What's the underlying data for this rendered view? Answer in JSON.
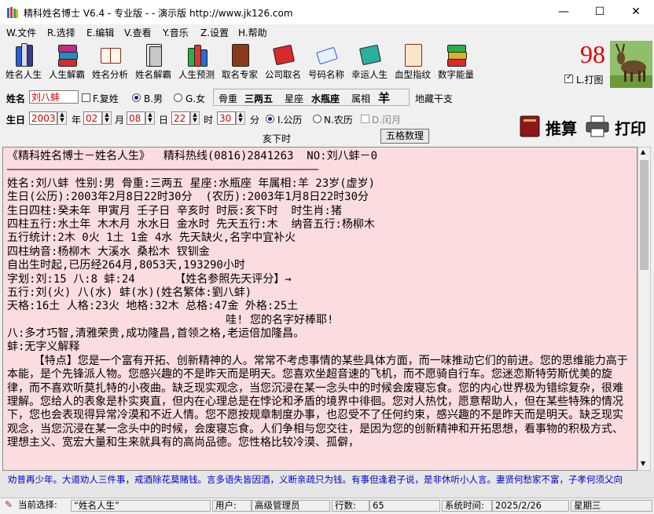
{
  "window": {
    "title": "精科姓名博士 V6.4 - 专业版 - - 演示版  http://www.jk126.com",
    "minimize": "—",
    "maximize": "☐",
    "close": "✕"
  },
  "menu": [
    "W.文件",
    "R.选择",
    "E.编辑",
    "V.查看",
    "Y.音乐",
    "Z.设置",
    "H.帮助"
  ],
  "toolbar": [
    "姓名人生",
    "人生解霸",
    "姓名分析",
    "姓名解霸",
    "人生预测",
    "取名专家",
    "公司取名",
    "号码名称",
    "幸运人生",
    "血型指纹",
    "数字能量"
  ],
  "score": {
    "value": "98",
    "print_label": "L.打图",
    "print_checked": true
  },
  "row1": {
    "name_label": "姓名",
    "name_value": "刘八蚌",
    "fuxing_label": "F.复姓",
    "male_label": "B.男",
    "female_label": "G.女",
    "gugu_label": "骨重",
    "gugu_value": "三两五",
    "xingzuo_label": "星座",
    "xingzuo_value": "水瓶座",
    "shuxiang_label": "属相",
    "shuxiang_value": "羊",
    "dizhi_label": "地藏干支"
  },
  "row2": {
    "birth_label": "生日",
    "year": "2003",
    "year_unit": "年",
    "month": "02",
    "month_unit": "月",
    "day": "08",
    "day_unit": "日",
    "hour": "22",
    "hour_unit": "时",
    "minute": "30",
    "minute_unit": "分",
    "gongli_label": "I.公历",
    "nongli_label": "N.农历",
    "runyue_label": "D.闰月",
    "shichen": "亥下时",
    "wuge_button": "五格数理",
    "tuisuan_button": "推算",
    "print_button": "打印"
  },
  "text_lines": [
    "《精科姓名博士－姓名人生》  精科热线(0816)2841263  NO:刘八蚌－0",
    "———————————————————————————————————————————————",
    "姓名:刘八蚌 性别:男 骨重:三两五 星座:水瓶座 年属相:羊 23岁(虚岁)",
    "生日(公历):2003年2月8日22时30分  (农历):2003年1月8日22时30分",
    "生日四柱:癸未年 甲寅月 壬子日 辛亥时 时辰:亥下时  时生肖:猪",
    "四柱五行:水土年 木木月 水水日 金水时 先天五行:木  纳音五行:杨柳木",
    "五行统计:2木 0火 1土 1金 4水 先天缺火,名字中宜补火",
    "四柱纳音:杨柳木 大溪水 桑松木 钗钏金",
    "自出生时起,已历经264月,8053天,193290小时",
    "字划:刘:15 八:8 蚌:24      【姓名参照先天评分】→",
    "五行:刘(火) 八(水) 蚌(水)(姓名繁体:劉八蚌)",
    "天格:16土 人格:23火 地格:32木 总格:47金 外格:25土",
    "                                 哇! 您的名字好棒耶!",
    "八:多才巧智,清雅荣贵,成功隆昌,首领之格,老运倍加隆昌。",
    "蚌:无字义解释"
  ],
  "paragraph": "    【特点】您是一个富有开拓、创新精神的人。常常不考虑事情的某些具体方面，而一味推动它们的前进。您的思维能力高于本能，是个先锋派人物。您感兴趣的不是昨天而是明天。您喜欢坐超音速的飞机，而不愿骑自行车。您迷恋斯特劳斯优美的旋律，而不喜欢听莫扎特的小夜曲。缺乏现实观念，当您沉浸在某一念头中的时候会废寝忘食。您的内心世界极为错综复杂，很难理解。您给人的表象是朴实爽直，但内在心理总是在悖论和矛盾的境界中徘徊。您对人热忱，愿意帮助人，但在某些特殊的情况下，您也会表现得异常冷漠和不近人情。您不愿按规章制度办事，也忍受不了任何约束，感兴趣的不是昨天而是明天。缺乏现实观念，当您沉浸在某一念头中的时候，会废寝忘食。人们争相与您交往，是因为您的创新精神和开拓思想，看事物的积极方式、理想主义、宽宏大量和生来就具有的高尚品德。您性格比较冷漠、孤僻，",
  "marquee": "劝普再少年。大道劝人三件事，戒酒除花莫赌钱。言多语失皆因酒，义断亲疏只为钱。有事但逢君子说，是非休听小人言。妻贤何愁家不富，子孝何须父向",
  "status": {
    "current_label": "当前选择:",
    "current_value": "“姓名人生”",
    "user_label": "用户:",
    "user_value": "高级管理员",
    "lines_label": "行数:",
    "lines_value": "65",
    "time_label": "系统时间:",
    "time_value": "2025/2/26",
    "weekday": "星期三"
  },
  "colors": {
    "text_bg": "#fcdddf",
    "score": "#e00000",
    "marquee": "#0000d0",
    "name_value": "#d00000"
  }
}
